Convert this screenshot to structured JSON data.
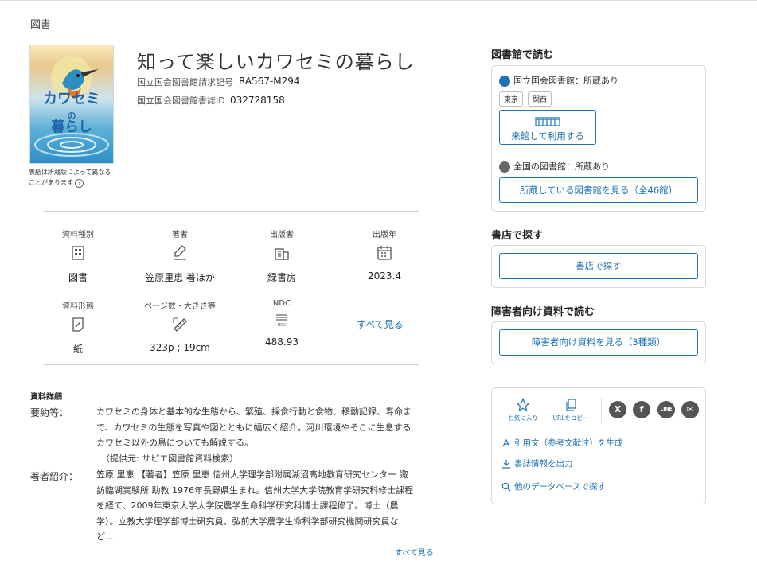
{
  "category": "図書",
  "cover": {
    "title_line1": "カワセミ",
    "title_line2": "の",
    "title_line3": "暮らし",
    "note": "表紙は所蔵版によって異なることがあります",
    "help_icon": "?"
  },
  "book": {
    "title": "知って楽しいカワセミの暮らし",
    "call_number_label": "国立国会図書館請求記号",
    "call_number": "RA567-M294",
    "bib_id_label": "国立国会図書館書誌ID",
    "bib_id": "032728158"
  },
  "facets": [
    {
      "label": "資料種別",
      "icon": "book-type-icon",
      "value": "図書"
    },
    {
      "label": "著者",
      "icon": "author-pen-icon",
      "value": "笠原里恵 著ほか"
    },
    {
      "label": "出版者",
      "icon": "publisher-building-icon",
      "value": "緑書房"
    },
    {
      "label": "出版年",
      "icon": "calendar-icon",
      "value": "2023.4"
    },
    {
      "label": "資料形態",
      "icon": "material-form-icon",
      "value": "紙"
    },
    {
      "label": "ページ数・大きさ等",
      "icon": "ruler-icon",
      "value": "323p ; 19cm"
    },
    {
      "label": "NDC",
      "icon": "ndc-icon",
      "value": "488.93",
      "icon_text": "NDC"
    }
  ],
  "facets_see_all": "すべて見る",
  "details": {
    "heading": "資料詳細",
    "summary_label": "要約等：",
    "summary_lines": [
      "カワセミの身体と基本的な生態から、繁殖、採食行動と食物、移動記録、寿命ま",
      "で、カワセミの生態を写真や図とともに幅広く紹介。河川環境やそこに生息する",
      "カワセミ以外の鳥についても解説する。",
      "（提供元: サピエ図書館資料検索）"
    ],
    "author_label": "著者紹介：",
    "author_lines": [
      "笠原 里恵 【著者】笠原 里恵 信州大学理学部附属湖沼高地教育研究センター 諏",
      "訪臨湖実験所 助教 1976年長野県生まれ。信州大学大学院教育学研究科修士課程",
      "を経て、2009年東京大学大学院農学生命科学研究科博士課程修了。博士（農",
      "学）。立教大学理学部博士研究員、弘前大学農学生命科学部研究機関研究員な",
      "ど..."
    ],
    "see_all": "すべて見る"
  },
  "sidebar": {
    "library_heading": "図書館で読む",
    "ndl_label": "国立国会図書館：所蔵あり",
    "chips": [
      "東京",
      "関西"
    ],
    "visit_button": "来館して利用する",
    "national_label": "全国の図書館：所蔵あり",
    "holding_button": "所蔵している図書館を見る（全46館）",
    "bookstore_heading": "書店で探す",
    "bookstore_button": "書店で探す",
    "accessible_heading": "障害者向け資料で読む",
    "accessible_button": "障害者向け資料を見る（3種類）",
    "favorite_label": "お気に入り",
    "copy_url_label": "URLをコピー",
    "social": [
      {
        "name": "x-share-icon",
        "glyph": "X"
      },
      {
        "name": "facebook-share-icon",
        "glyph": "f"
      },
      {
        "name": "line-share-icon",
        "glyph": "LINE"
      },
      {
        "name": "mail-share-icon",
        "glyph": "✉"
      }
    ],
    "citation_link": "引用文（参考文献注）を生成",
    "export_link": "書誌情報を出力",
    "other_db_link": "他のデータベースで探す"
  },
  "colors": {
    "accent": "#1f73b5",
    "border": "#d8d8d8"
  }
}
